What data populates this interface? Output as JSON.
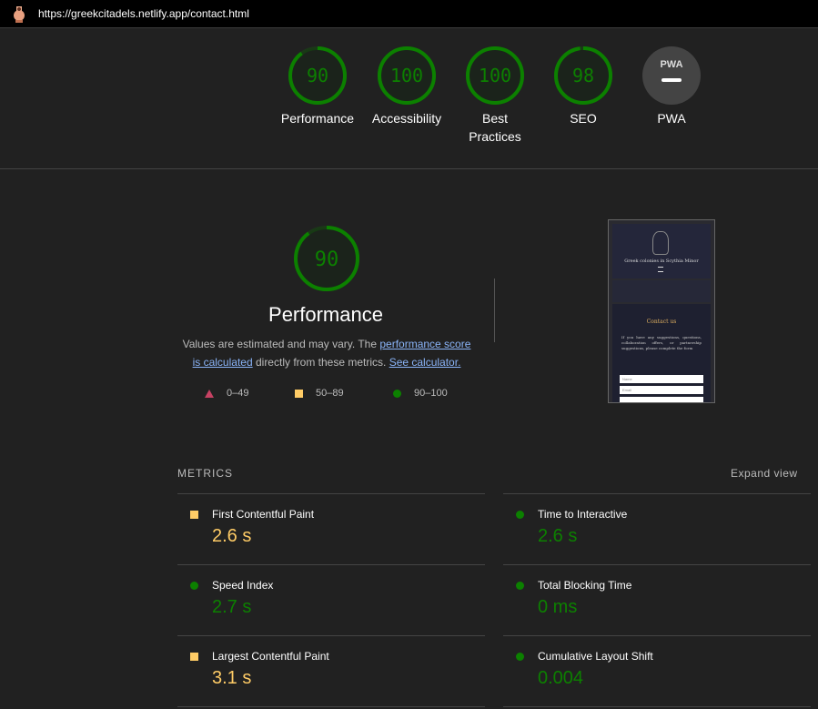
{
  "browser": {
    "url": "https://greekcitadels.netlify.app/contact.html",
    "favicon": "amphora-icon"
  },
  "colors": {
    "pass": "#0c8000",
    "average": "#ffcc66",
    "fail": "#ff4e7a",
    "pwa_bg": "#444444",
    "background": "#212121"
  },
  "scores": [
    {
      "label": "Performance",
      "value": "90",
      "score": 90
    },
    {
      "label": "Accessibility",
      "value": "100",
      "score": 100
    },
    {
      "label_line1": "Best",
      "label_line2": "Practices",
      "value": "100",
      "score": 100
    },
    {
      "label": "SEO",
      "value": "98",
      "score": 98
    },
    {
      "label": "PWA",
      "badge": "PWA",
      "value": null
    }
  ],
  "performance": {
    "score": "90",
    "title": "Performance",
    "desc_text1": "Values are estimated and may vary. The ",
    "desc_link1": "performance score is calculated",
    "desc_text2": " directly from these metrics. ",
    "desc_link2": "See calculator.",
    "legend": [
      {
        "range": "0–49",
        "icon": "triangle-icon"
      },
      {
        "range": "50–89",
        "icon": "square-icon"
      },
      {
        "range": "90–100",
        "icon": "circle-icon"
      }
    ]
  },
  "thumbnail": {
    "site_title": "Greek colonies in Scythia Minor",
    "heading": "Contact us",
    "paragraph": "If you have any suggestions, questions, collaboration offers, or partnership suggestions, please complete the form",
    "name_placeholder": "Name",
    "email_placeholder": "Email"
  },
  "metrics": {
    "header": "METRICS",
    "expand": "Expand view",
    "items": [
      {
        "name": "First Contentful Paint",
        "value": "2.6 s",
        "status": "average"
      },
      {
        "name": "Time to Interactive",
        "value": "2.6 s",
        "status": "pass"
      },
      {
        "name": "Speed Index",
        "value": "2.7 s",
        "status": "pass"
      },
      {
        "name": "Total Blocking Time",
        "value": "0 ms",
        "status": "pass"
      },
      {
        "name": "Largest Contentful Paint",
        "value": "3.1 s",
        "status": "average"
      },
      {
        "name": "Cumulative Layout Shift",
        "value": "0.004",
        "status": "pass"
      }
    ]
  }
}
